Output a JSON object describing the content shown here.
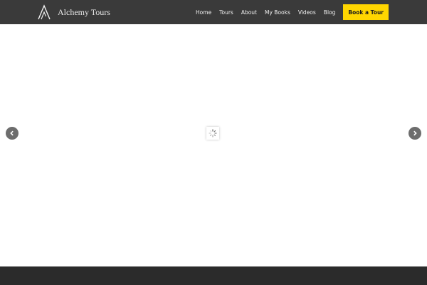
{
  "header": {
    "brand": "Alchemy Tours",
    "logo_icon": "alchemy-tours-logo-icon",
    "background": "#3a3a3a"
  },
  "nav": {
    "items": [
      {
        "label": "Home"
      },
      {
        "label": "Tours"
      },
      {
        "label": "About"
      },
      {
        "label": "My Books"
      },
      {
        "label": "Videos"
      },
      {
        "label": "Blog"
      }
    ],
    "cta_label": "Book a Tour",
    "cta_color": "#ffd600"
  },
  "slider": {
    "prev_icon": "chevron-left-icon",
    "next_icon": "chevron-right-icon",
    "loading_icon": "loading-spinner-icon"
  },
  "footer": {
    "background": "#2b2b2b"
  }
}
